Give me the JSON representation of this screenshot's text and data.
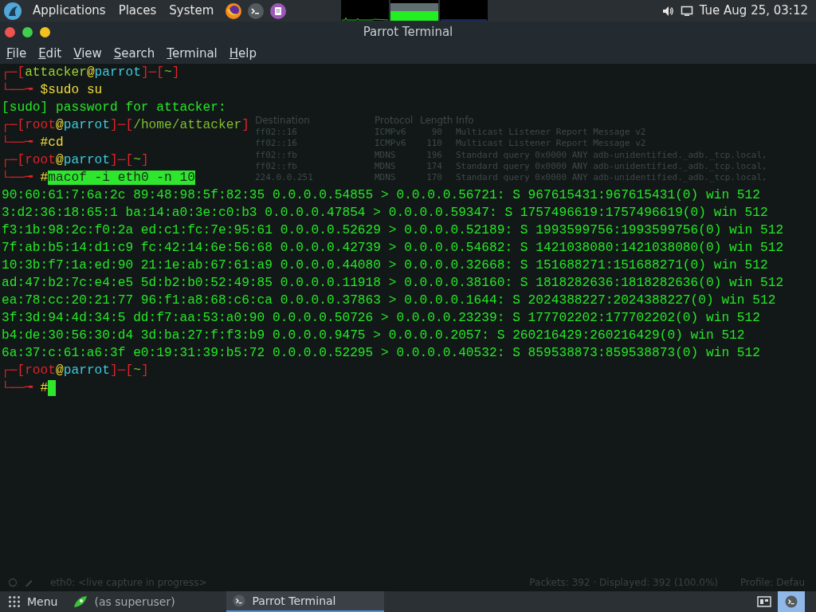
{
  "top_panel": {
    "menus": [
      "Applications",
      "Places",
      "System"
    ],
    "clock": "Tue Aug 25, 03:12"
  },
  "window": {
    "title": "Parrot Terminal"
  },
  "menu_bar": [
    "File",
    "Edit",
    "View",
    "Search",
    "Terminal",
    "Help"
  ],
  "terminal": {
    "lines": [
      {
        "kind": "prompt_head",
        "open": "┌─[",
        "user": "attacker",
        "at": "@",
        "host": "parrot",
        "sep": "]─[",
        "dir": "~",
        "close": "]"
      },
      {
        "kind": "prompt_cmd",
        "lead": "└──╼ ",
        "sign": "$",
        "command": "sudo su",
        "selected": false
      },
      {
        "kind": "output",
        "text": "[sudo] password for attacker:"
      },
      {
        "kind": "prompt_head",
        "open": "┌─[",
        "user": "root",
        "at": "@",
        "host": "parrot",
        "sep": "]─[",
        "dir": "/home/attacker",
        "close": "]"
      },
      {
        "kind": "prompt_cmd",
        "lead": "└──╼ ",
        "sign": "#",
        "command": "cd",
        "selected": false
      },
      {
        "kind": "prompt_head",
        "open": "┌─[",
        "user": "root",
        "at": "@",
        "host": "parrot",
        "sep": "]─[",
        "dir": "~",
        "close": "]"
      },
      {
        "kind": "prompt_cmd",
        "lead": "└──╼ ",
        "sign": "#",
        "command": "macof -i eth0 -n 10",
        "selected": true
      },
      {
        "kind": "output",
        "text": "90:60:61:7:6a:2c 89:48:98:5f:82:35 0.0.0.0.54855 > 0.0.0.0.56721: S 967615431:967615431(0) win 512"
      },
      {
        "kind": "output",
        "text": "3:d2:36:18:65:1 ba:14:a0:3e:c0:b3 0.0.0.0.47854 > 0.0.0.0.59347: S 1757496619:1757496619(0) win 512"
      },
      {
        "kind": "output",
        "text": "f3:1b:98:2c:f0:2a ed:c1:fc:7e:95:61 0.0.0.0.52629 > 0.0.0.0.52189: S 1993599756:1993599756(0) win 512"
      },
      {
        "kind": "output",
        "text": "7f:ab:b5:14:d1:c9 fc:42:14:6e:56:68 0.0.0.0.42739 > 0.0.0.0.54682: S 1421038080:1421038080(0) win 512"
      },
      {
        "kind": "output",
        "text": "10:3b:f7:1a:ed:90 21:1e:ab:67:61:a9 0.0.0.0.44080 > 0.0.0.0.32668: S 151688271:151688271(0) win 512"
      },
      {
        "kind": "output",
        "text": "ad:47:b2:7c:e4:e5 5d:b2:b0:52:49:85 0.0.0.0.11918 > 0.0.0.0.38160: S 1818282636:1818282636(0) win 512"
      },
      {
        "kind": "output",
        "text": "ea:78:cc:20:21:77 96:f1:a8:68:c6:ca 0.0.0.0.37863 > 0.0.0.0.1644: S 2024388227:2024388227(0) win 512"
      },
      {
        "kind": "output",
        "text": "3f:3d:94:4d:34:5 dd:f7:aa:53:a0:90 0.0.0.0.50726 > 0.0.0.0.23239: S 177702202:177702202(0) win 512"
      },
      {
        "kind": "output",
        "text": "b4:de:30:56:30:d4 3d:ba:27:f:f3:b9 0.0.0.0.9475 > 0.0.0.0.2057: S 260216429:260216429(0) win 512"
      },
      {
        "kind": "output",
        "text": "6a:37:c:61:a6:3f e0:19:31:39:b5:72 0.0.0.0.52295 > 0.0.0.0.40532: S 859538873:859538873(0) win 512"
      },
      {
        "kind": "prompt_head",
        "open": "┌─[",
        "user": "root",
        "at": "@",
        "host": "parrot",
        "sep": "]─[",
        "dir": "~",
        "close": "]"
      },
      {
        "kind": "prompt_cursor",
        "lead": "└──╼ ",
        "sign": "#",
        "cursor": true
      }
    ]
  },
  "background_capture": {
    "columns": [
      "Destination",
      "Protocol",
      "Length",
      "Info"
    ],
    "rows": [
      {
        "destination": "ff02::16",
        "protocol": "ICMPv6",
        "length": "90",
        "info": "Multicast Listener Report Message v2"
      },
      {
        "destination": "ff02::16",
        "protocol": "ICMPv6",
        "length": "110",
        "info": "Multicast Listener Report Message v2"
      },
      {
        "destination": "ff02::fb",
        "protocol": "MDNS",
        "length": "196",
        "info": "Standard query 0x0000 ANY adb-unidentified._adb._tcp.local,"
      },
      {
        "destination": "ff02::fb",
        "protocol": "MDNS",
        "length": "174",
        "info": "Standard query 0x0000 ANY adb-unidentified._adb._tcp.local,"
      },
      {
        "destination": "224.0.0.251",
        "protocol": "MDNS",
        "length": "170",
        "info": "Standard query 0x0000 ANY adb-unidentified._adb._tcp.local,"
      }
    ],
    "status": {
      "capture": "eth0: <live capture in progress>",
      "packets": "Packets: 392 · Displayed: 392 (100.0%)",
      "profile": "Profile: Defau"
    }
  },
  "taskbar": {
    "menu": "Menu",
    "items": [
      {
        "kind": "leaf",
        "label": "(as superuser)",
        "selected": false
      },
      {
        "kind": "terminal",
        "label": "Parrot Terminal",
        "selected": true
      }
    ]
  }
}
